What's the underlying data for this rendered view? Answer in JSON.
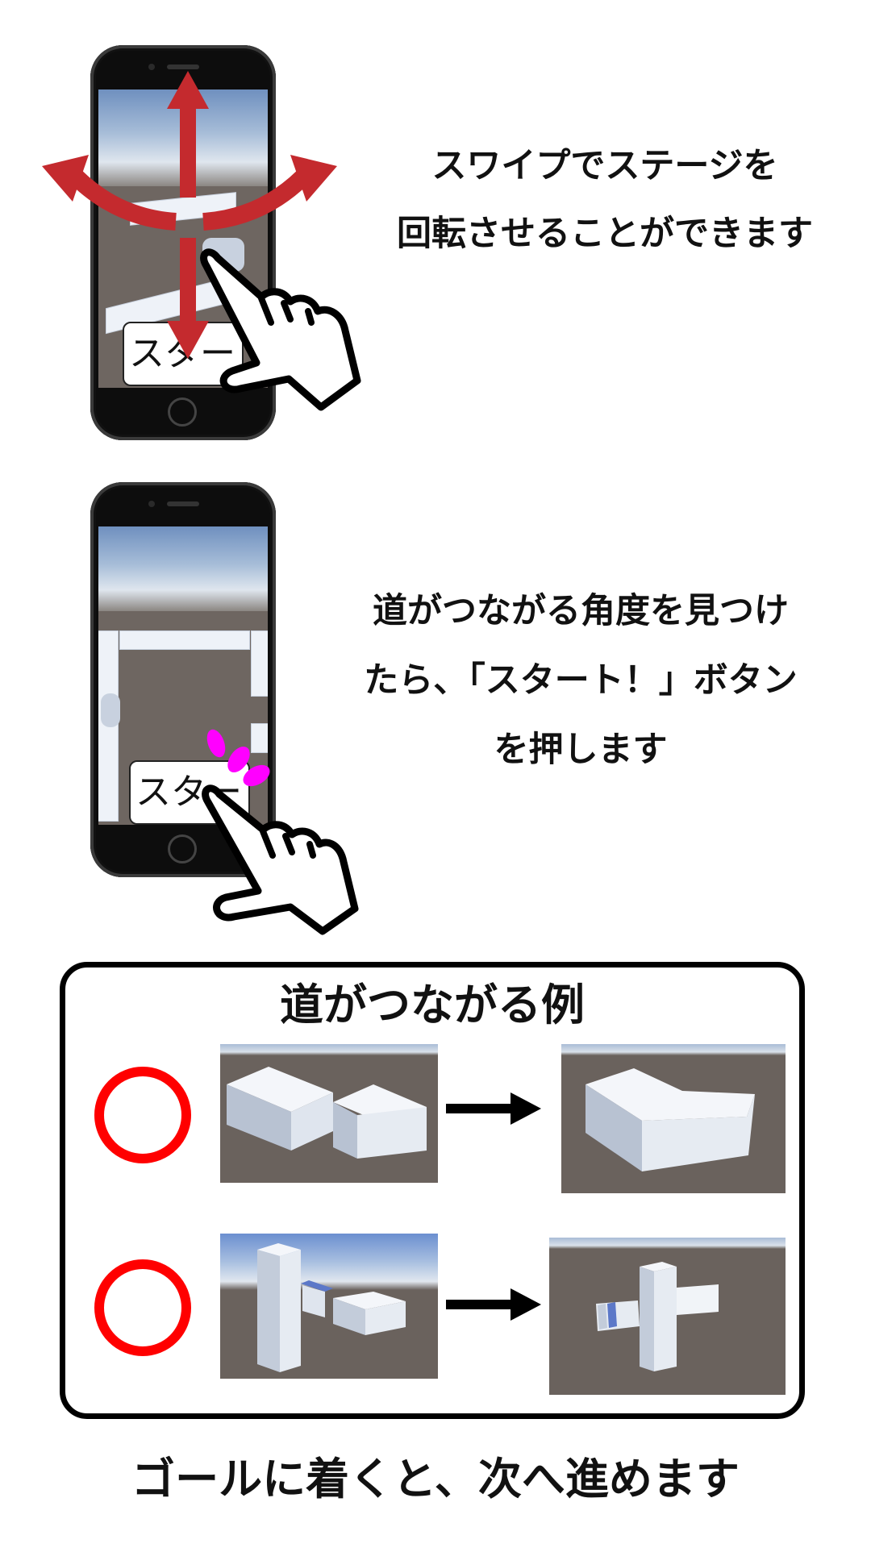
{
  "step1": {
    "caption_line1": "スワイプでステージを",
    "caption_line2": "回転させることができます",
    "button_label": "スタート！"
  },
  "step2": {
    "caption_line1": "道がつながる角度を見つけ",
    "caption_line2": "たら、「スタート！」ボタン",
    "caption_line3": "を押します",
    "button_label": "スタート！"
  },
  "examples": {
    "title": "道がつながる例",
    "rows": [
      {
        "mark": "ok-circle"
      },
      {
        "mark": "ok-circle"
      }
    ]
  },
  "footer": {
    "text": "ゴールに着くと、次へ進めます"
  },
  "colors": {
    "swipe_arrow": "#c42a2e",
    "tap_marks": "#ff00ff",
    "ok_mark": "#ff0000",
    "stage_floor": "#6a625d"
  },
  "icons": [
    "swipe-arrows-icon",
    "pointing-hand-icon",
    "tap-burst-icon",
    "right-arrow-icon",
    "ok-circle-icon"
  ]
}
